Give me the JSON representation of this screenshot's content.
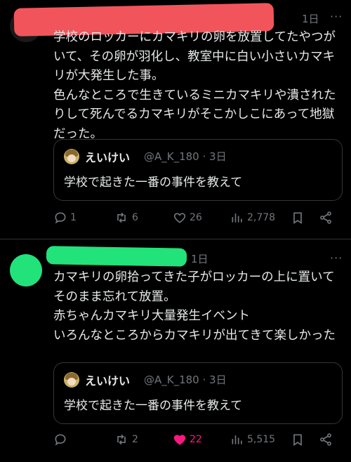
{
  "posts": [
    {
      "time": "1日",
      "text": "学校のロッカーにカマキリの卵を放置してたやつがいて、その卵が羽化し、教室中に白い小さいカマキリが大発生した事。\n色んなところで生きているミニカマキリや潰されたりして死んでるカマキリがそこかしこにあって地獄だった。",
      "quote": {
        "name": "えいけい",
        "handle": "@A_K_180 · 3日",
        "text": "学校で起きた一番の事件を教えて"
      },
      "actions": {
        "replies": "1",
        "reposts": "6",
        "likes": "26",
        "views": "2,778"
      }
    },
    {
      "time": "1日",
      "text": "カマキリの卵拾ってきた子がロッカーの上に置いてそのまま忘れて放置。\n赤ちゃんカマキリ大量発生イベント\nいろんなところからカマキリが出てきて楽しかった",
      "quote": {
        "name": "えいけい",
        "handle": "@A_K_180 · 3日",
        "text": "学校で起きた一番の事件を教えて"
      },
      "actions": {
        "replies": "",
        "reposts": "2",
        "likes": "22",
        "views": "5,515"
      }
    }
  ],
  "colors": {
    "redact_top": "#f2545b",
    "redact_bottom": "#22e27a",
    "like_active": "#f91880"
  },
  "icons": [
    "reply-icon",
    "repost-icon",
    "heart-icon",
    "views-icon",
    "bookmark-icon",
    "share-icon",
    "more-icon"
  ]
}
